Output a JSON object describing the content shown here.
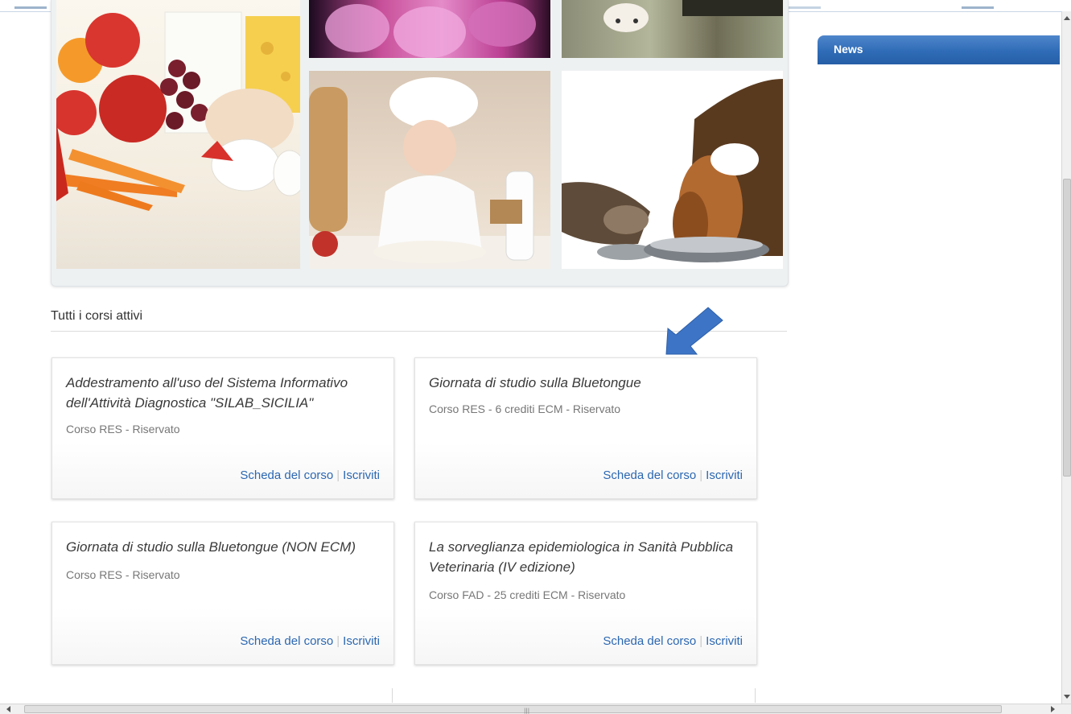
{
  "section": {
    "title": "Tutti i corsi attivi"
  },
  "news": {
    "title": "News"
  },
  "courses": [
    {
      "title": "Addestramento all'uso del Sistema Informativo dell'Attività Diagnostica \"SILAB_SICILIA\"",
      "meta": "Corso RES - Riservato",
      "details_link": "Scheda del corso",
      "enroll_link": "Iscriviti"
    },
    {
      "title": "Giornata di studio sulla Bluetongue",
      "meta": "Corso RES - 6 crediti ECM - Riservato",
      "details_link": "Scheda del corso",
      "enroll_link": "Iscriviti"
    },
    {
      "title": "Giornata di studio sulla Bluetongue (NON ECM)",
      "meta": "Corso RES - Riservato",
      "details_link": "Scheda del corso",
      "enroll_link": "Iscriviti"
    },
    {
      "title": "La sorveglianza epidemiologica in Sanità Pubblica Veterinaria (IV edizione)",
      "meta": "Corso FAD - 25 crediti ECM - Riservato",
      "details_link": "Scheda del corso",
      "enroll_link": "Iscriviti"
    }
  ],
  "colors": {
    "link": "#2b67b1",
    "news_header": "#2f6cb7",
    "arrow": "#3d74c6"
  },
  "icons": {
    "pointer_arrow": "arrow-down-left-icon"
  }
}
